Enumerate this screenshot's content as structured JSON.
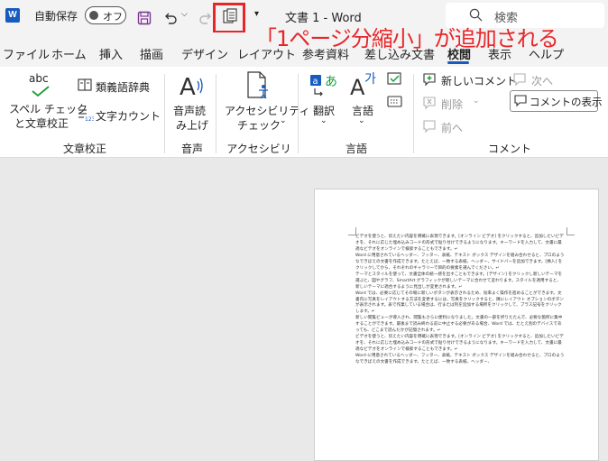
{
  "titlebar": {
    "app_logo": "W",
    "autosave_label": "自動保存",
    "autosave_state": "オフ",
    "doc_title": "文書 1  -  Word",
    "search_placeholder": "検索",
    "icons": [
      "save-icon",
      "undo-icon",
      "redo-icon",
      "fit-to-one-page-icon",
      "search-icon"
    ]
  },
  "annotation": "「1ページ分縮小」が追加される",
  "tabs": [
    "ファイル",
    "ホーム",
    "挿入",
    "描画",
    "デザイン",
    "レイアウト",
    "参考資料",
    "差し込み文書",
    "校閲",
    "表示",
    "ヘルプ"
  ],
  "active_tab": "校閲",
  "ribbon": {
    "proofing": {
      "group": "文章校正",
      "spelling": "スペル チェック",
      "spelling2": "と文章校正",
      "abc": "abc",
      "thesaurus": "類義語辞典",
      "word_count": "文字カウント"
    },
    "speech": {
      "group": "音声",
      "read_aloud": "音声読",
      "read_aloud2": "み上げ"
    },
    "accessibility": {
      "group": "アクセシビリティ",
      "check": "アクセシビリティ",
      "check2": "チェック"
    },
    "language": {
      "group": "言語",
      "translate": "翻訳",
      "language": "言語"
    },
    "comments": {
      "group": "コメント",
      "new_comment": "新しいコメント",
      "delete": "削除",
      "previous": "前へ",
      "next": "次へ",
      "show_comments": "コメントの表示"
    }
  },
  "document": {
    "paragraphs": [
      "ビデオを使うと、伝えたい内容を明確に表現できます。[オンライン ビデオ] をクリックすると、追加したいビデオを、それに応じた埋め込みコードの形式で貼り付けできるようになります。キーワードを入力して、文書に最適なビデオをオンラインで検索することもできます。↵",
      "Word に用意されているヘッダー、フッター、表紙、テキスト ボックス デザインを組み合わせると、プロのようなできばえの文書を作成できます。たとえば、一致する表紙、ヘッダー、サイドバーを追加できます。[挿入] をクリックしてから、それぞれのギャラリーで目的の要素を選んでください。↵",
      "テーマとスタイルを使って、文書全体の統一感を出すこともできます。[デザイン] をクリックし新しいテーマを選ぶと、図やグラフ、SmartArt グラフィックが新しいテーマに合わせて変わります。スタイルを適用すると、新しいテーマに適合するように見出しが変更されます。↵",
      "Word では、必要に応じてその場に新しいボタンが表示されるため、効率よく操作を進めることができます。文書内に写真をレイアウトする方法を変更するには、写真をクリックすると、隣にレイアウト オプションのボタンが表示されます。表で作業している場合は、行または列を追加する場所をクリックして、プラス記号をクリックします。↵",
      "新しい閲覧ビューが導入され、閲覧もさらに便利になりました。文書の一部を折りたたんで、必要な箇所に集中することができます。最後まで読み終わる前に中止する必要がある場合、Word では、たとえ別のデバイスであっても、どこまで読んだかが記憶されます。↵",
      "ビデオを使うと、伝えたい内容を明確に表現できます。[オンライン ビデオ] をクリックすると、追加したいビデオを、それに応じた埋め込みコードの形式で貼り付けできるようになります。キーワードを入力して、文書に最適なビデオをオンラインで検索することもできます。↵",
      "Word に用意されているヘッダー、フッター、表紙、テキスト ボックス デザインを組み合わせると、プロのようなできばえの文書を作成できます。たとえば、一致する表紙、ヘッダー、"
    ]
  }
}
